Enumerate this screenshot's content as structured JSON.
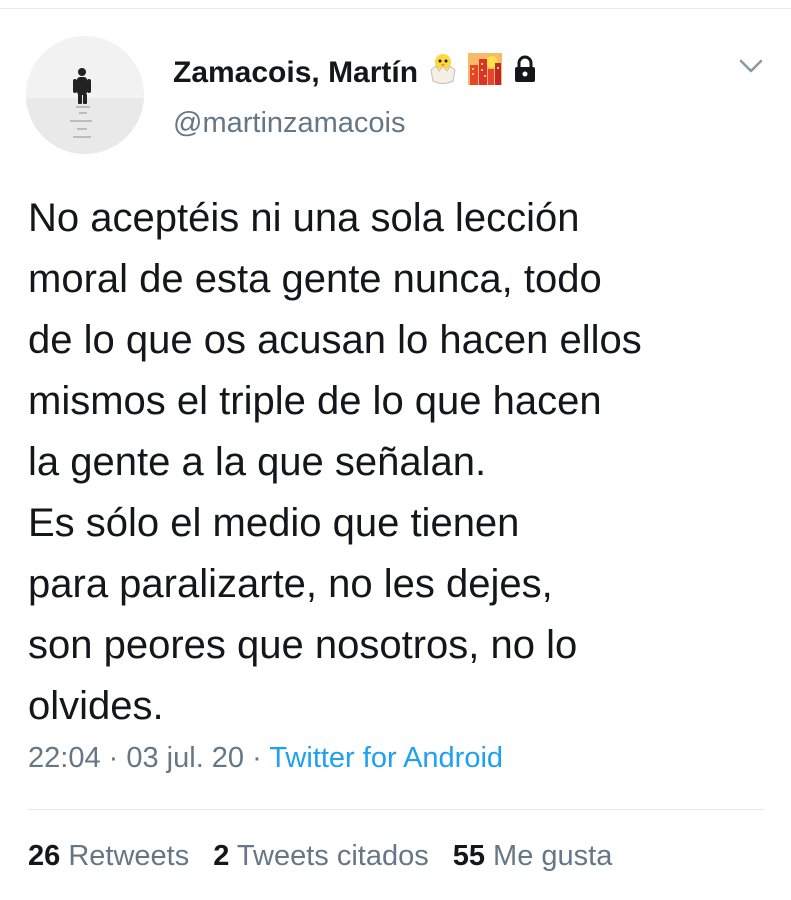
{
  "user": {
    "display_name": "Zamacois, Martín",
    "handle": "@martinzamacois",
    "badges": [
      "hatching-chick-icon",
      "cityscape-dusk-icon",
      "lock-icon"
    ]
  },
  "tweet": {
    "text": "No aceptéis ni una sola lección\nmoral de esta gente nunca, todo\nde lo que os acusan lo hacen ellos\nmismos el triple de lo que hacen\nla gente a la que señalan.\nEs sólo el medio que tienen\npara paralizarte, no les dejes,\nson peores que nosotros, no lo\nolvides.",
    "time": "22:04",
    "sep1": " · ",
    "date": "03 jul. 20",
    "sep2": " · ",
    "source": "Twitter for Android"
  },
  "stats": {
    "retweets_count": "26",
    "retweets_label": " Retweets",
    "quotes_count": "2",
    "quotes_label": " Tweets citados",
    "likes_count": "55",
    "likes_label": " Me gusta"
  },
  "colors": {
    "text": "#14171a",
    "secondary": "#657786",
    "link": "#1da1f2",
    "divider": "#e1e8ed"
  }
}
